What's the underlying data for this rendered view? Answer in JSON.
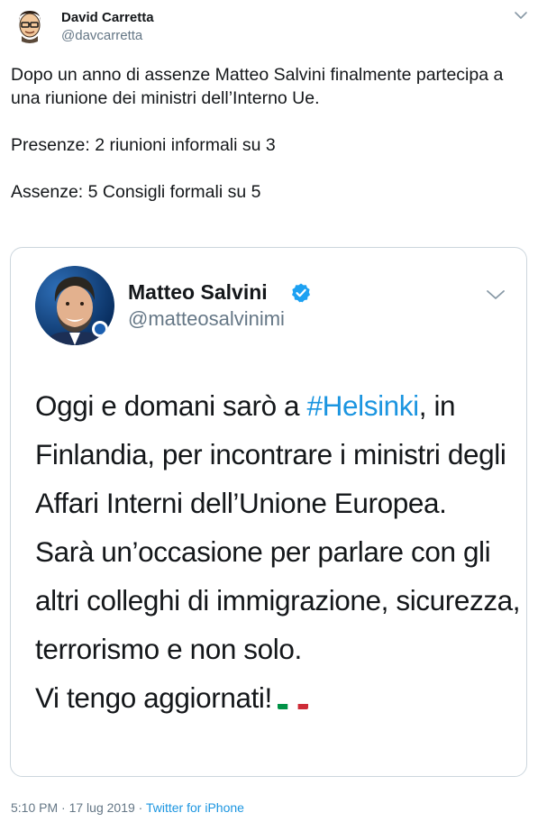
{
  "tweet": {
    "author_name": "David Carretta",
    "author_handle": "@davcarretta",
    "text_lines": [
      "Dopo un anno di assenze Matteo Salvini finalmente partecipa a una riunione dei ministri dell’Interno Ue.",
      "Presenze: 2 riunioni informali su 3",
      "Assenze: 5 Consigli formali su 5"
    ],
    "menu_icon": "chevron-down-icon"
  },
  "quoted": {
    "author_name": "Matteo Salvini",
    "author_handle": "@matteosalvinimi",
    "verified_icon": "verified-badge-icon",
    "text_before": "Oggi e domani sarò a ",
    "hashtag": "#Helsinki",
    "text_after": ", in Finlandia, per incontrare i ministri degli Affari Interni dell’Unione Europea.",
    "text_line2": "Sarà un’occasione per parlare con gli altri colleghi di immigrazione, sicurezza, terrorismo e non solo.",
    "text_line3": "Vi tengo aggiornati!",
    "flag_icon": "italy-flag-icon"
  },
  "meta": {
    "time": "5:10 PM",
    "separator1": " · ",
    "date": "17 lug 2019",
    "separator2": " · ",
    "source": "Twitter for iPhone"
  },
  "colors": {
    "text": "#14171a",
    "secondary": "#657786",
    "link": "#1b95e0",
    "border": "#ccd6dd"
  }
}
